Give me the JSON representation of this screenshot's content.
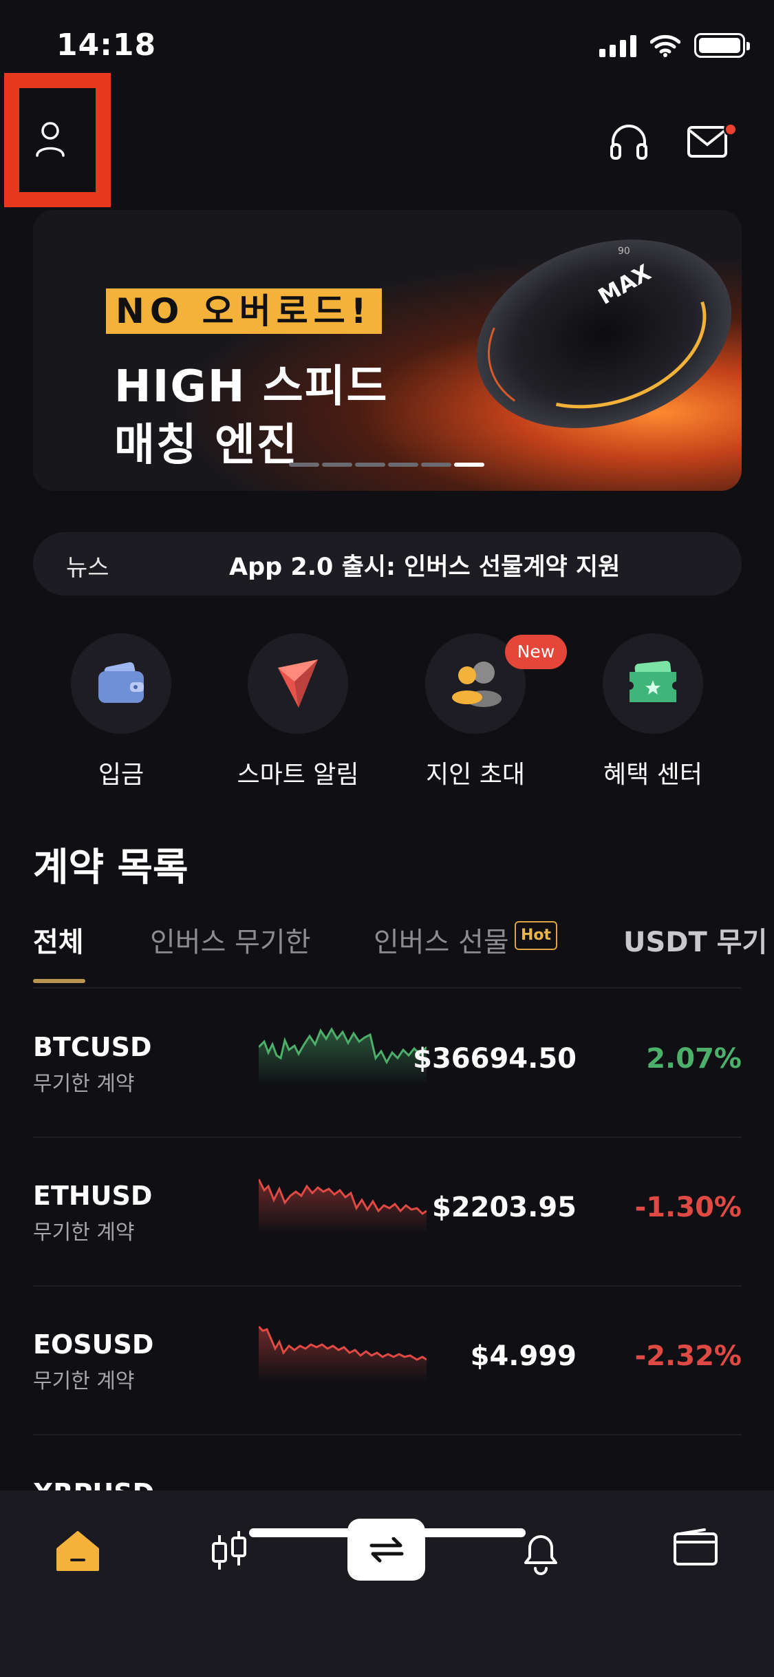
{
  "status_bar": {
    "time": "14:18"
  },
  "banner": {
    "tag": "NO 오버로드!",
    "line1": "HIGH 스피드",
    "line2": "매칭 엔진",
    "dial_label": "MAX",
    "dial_number": "90"
  },
  "news": {
    "label": "뉴스",
    "text": "App 2.0 출시: 인버스 선물계약 지원"
  },
  "quick_actions": [
    {
      "label": "입금",
      "icon": "wallet-icon"
    },
    {
      "label": "스마트 알림",
      "icon": "smart-alert-icon"
    },
    {
      "label": "지인 초대",
      "icon": "invite-friends-icon",
      "badge": "New"
    },
    {
      "label": "혜택 센터",
      "icon": "rewards-ticket-icon"
    }
  ],
  "contracts": {
    "title": "계약 목록",
    "tabs": [
      {
        "label": "전체",
        "active": true
      },
      {
        "label": "인버스 무기한"
      },
      {
        "label": "인버스 선물",
        "badge": "Hot"
      },
      {
        "label": "USDT 무기"
      }
    ],
    "rows": [
      {
        "symbol": "BTCUSD",
        "type": "무기한 계약",
        "price": "$36694.50",
        "change": "2.07%",
        "trend": "up"
      },
      {
        "symbol": "ETHUSD",
        "type": "무기한 계약",
        "price": "$2203.95",
        "change": "-1.30%",
        "trend": "down"
      },
      {
        "symbol": "EOSUSD",
        "type": "무기한 계약",
        "price": "$4.999",
        "change": "-2.32%",
        "trend": "down"
      },
      {
        "symbol": "XRPUSD",
        "type": "",
        "price": "",
        "change": "",
        "trend": "up"
      }
    ]
  },
  "bottom_nav": [
    {
      "name": "home",
      "icon": "home-icon",
      "active": true
    },
    {
      "name": "markets",
      "icon": "candlestick-icon"
    },
    {
      "name": "trade",
      "icon": "swap-arrows-icon"
    },
    {
      "name": "alerts",
      "icon": "bell-icon"
    },
    {
      "name": "wallet",
      "icon": "wallet-icon"
    }
  ],
  "colors": {
    "background": "#0f0f14",
    "accent": "#f5b23a",
    "up": "#4caf6a",
    "down": "#e04a44",
    "highlight": "#e8391c"
  }
}
